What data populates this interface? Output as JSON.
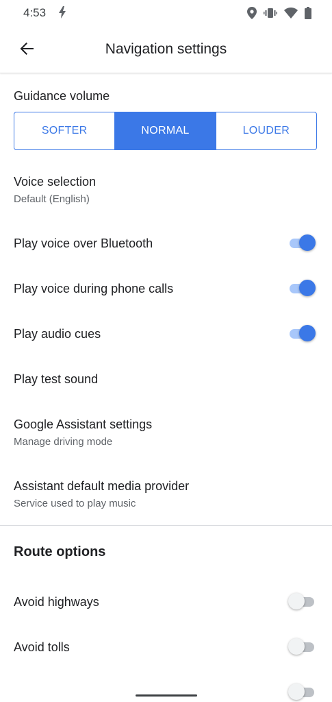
{
  "status_bar": {
    "time": "4:53",
    "icons": [
      "flash-icon",
      "location-icon",
      "vibrate-icon",
      "wifi-icon",
      "battery-icon"
    ]
  },
  "app_bar": {
    "title": "Navigation settings",
    "back_icon": "arrow-back-icon"
  },
  "guidance_volume": {
    "label": "Guidance volume",
    "options": [
      "SOFTER",
      "NORMAL",
      "LOUDER"
    ],
    "selected": "NORMAL"
  },
  "voice_selection": {
    "title": "Voice selection",
    "value": "Default (English)"
  },
  "toggles": [
    {
      "label": "Play voice over Bluetooth",
      "on": true
    },
    {
      "label": "Play voice during phone calls",
      "on": true
    },
    {
      "label": "Play audio cues",
      "on": true
    }
  ],
  "play_test_sound": "Play test sound",
  "assistant_settings": {
    "title": "Google Assistant settings",
    "subtitle": "Manage driving mode"
  },
  "media_provider": {
    "title": "Assistant default media provider",
    "subtitle": "Service used to play music"
  },
  "route_options": {
    "heading": "Route options",
    "items": [
      {
        "label": "Avoid highways",
        "on": false
      },
      {
        "label": "Avoid tolls",
        "on": false
      }
    ]
  },
  "colors": {
    "accent": "#3b78e7",
    "accent_track": "#a8c7fa",
    "text_primary": "#202124",
    "text_secondary": "#5f6368"
  }
}
